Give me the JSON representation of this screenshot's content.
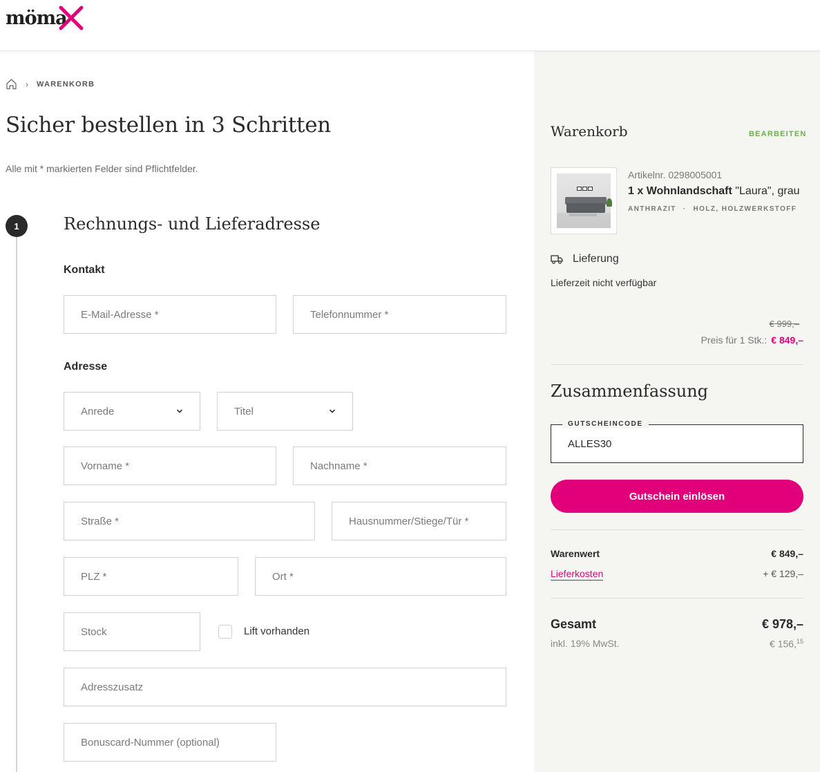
{
  "header": {
    "logo_text": "möma"
  },
  "breadcrumb": {
    "current": "WARENKORB"
  },
  "page": {
    "title": "Sicher bestellen in 3 Schritten",
    "required_note": "Alle mit * markierten Felder sind Pflichtfelder."
  },
  "step1": {
    "number": "1",
    "title": "Rechnungs- und Lieferadresse",
    "contact_label": "Kontakt",
    "address_label": "Adresse",
    "fields": {
      "email": "E-Mail-Adresse *",
      "phone": "Telefonnummer *",
      "salutation": "Anrede",
      "title": "Titel",
      "firstname": "Vorname *",
      "lastname": "Nachname *",
      "street": "Straße *",
      "housenumber": "Hausnummer/Stiege/Tür *",
      "zip": "PLZ *",
      "city": "Ort *",
      "floor": "Stock",
      "address_extra": "Adresszusatz",
      "bonuscard": "Bonuscard-Nummer (optional)"
    },
    "lift_label": "Lift vorhanden"
  },
  "cart": {
    "title": "Warenkorb",
    "edit_label": "BEARBEITEN",
    "item": {
      "article_no": "Artikelnr. 0298005001",
      "qty_name": "1 x Wohnlandschaft",
      "name_suffix": " \"Laura\", grau",
      "attr_color": "ANTHRAZIT",
      "attr_sep": "·",
      "attr_material": "HOLZ, HOLZWERKSTOFF"
    },
    "delivery_label": "Lieferung",
    "delivery_time": "Lieferzeit nicht verfügbar",
    "old_price": "€ 999,–",
    "price_label": "Preis für 1 Stk.:",
    "price": "€ 849,–"
  },
  "summary": {
    "title": "Zusammenfassung",
    "voucher_legend": "GUTSCHEINCODE",
    "voucher_value": "ALLES30",
    "voucher_button": "Gutschein einlösen",
    "goods_label": "Warenwert",
    "goods_value": "€ 849,–",
    "shipping_label": "Lieferkosten",
    "shipping_value": "+ € 129,–",
    "total_label": "Gesamt",
    "total_value": "€ 978,–",
    "tax_label": "inkl. 19% MwSt.",
    "tax_value": "€ 156,",
    "tax_cents": "15"
  },
  "colors": {
    "brand_pink": "#e2007a",
    "edit_green": "#6ab04c",
    "sidebar_bg": "#f5f5f2"
  }
}
